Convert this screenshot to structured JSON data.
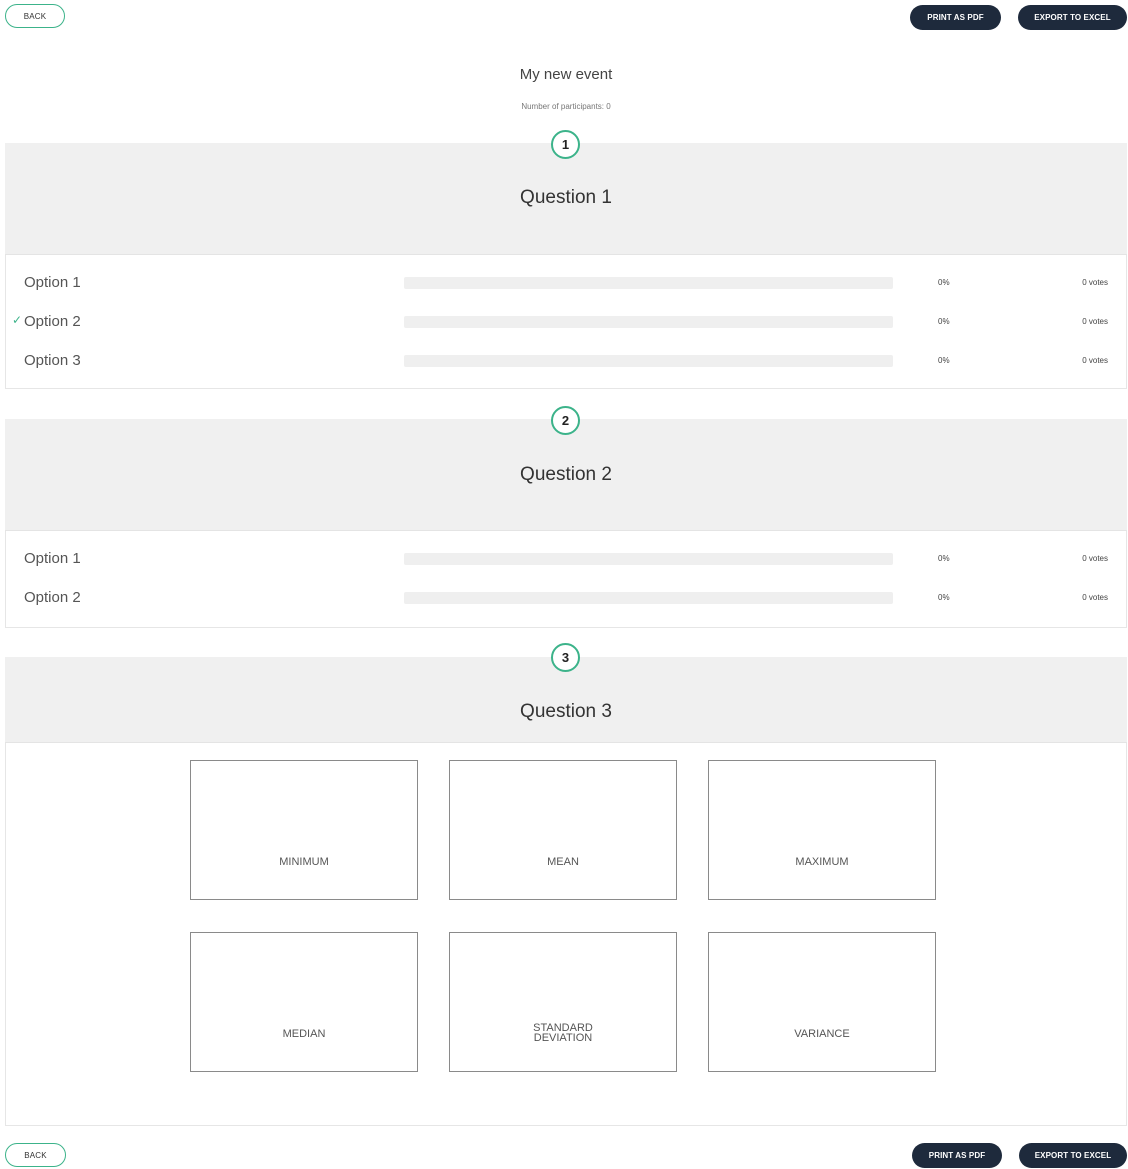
{
  "toolbar": {
    "back_label": "BACK",
    "print_label": "PRINT AS PDF",
    "excel_label": "EXPORT TO EXCEL"
  },
  "event": {
    "title": "My new event",
    "participants": "Number of participants: 0"
  },
  "questions": [
    {
      "number": "1",
      "title": "Question 1",
      "options": [
        {
          "label": "Option 1",
          "percent": "0%",
          "votes": "0 votes",
          "correct": false,
          "fill": 0
        },
        {
          "label": "Option 2",
          "percent": "0%",
          "votes": "0 votes",
          "correct": true,
          "fill": 0
        },
        {
          "label": "Option 3",
          "percent": "0%",
          "votes": "0 votes",
          "correct": false,
          "fill": 0
        }
      ]
    },
    {
      "number": "2",
      "title": "Question 2",
      "options": [
        {
          "label": "Option 1",
          "percent": "0%",
          "votes": "0 votes",
          "correct": false,
          "fill": 0
        },
        {
          "label": "Option 2",
          "percent": "0%",
          "votes": "0 votes",
          "correct": false,
          "fill": 0
        }
      ]
    },
    {
      "number": "3",
      "title": "Question 3",
      "stats": [
        "MINIMUM",
        "MEAN",
        "MAXIMUM",
        "MEDIAN",
        "STANDARD DEVIATION",
        "VARIANCE"
      ]
    }
  ],
  "icons": {
    "check": "check-icon"
  },
  "colors": {
    "accent": "#3cb38a",
    "dark_button": "#1e2a3c",
    "header_bg": "#f0f0f0"
  }
}
